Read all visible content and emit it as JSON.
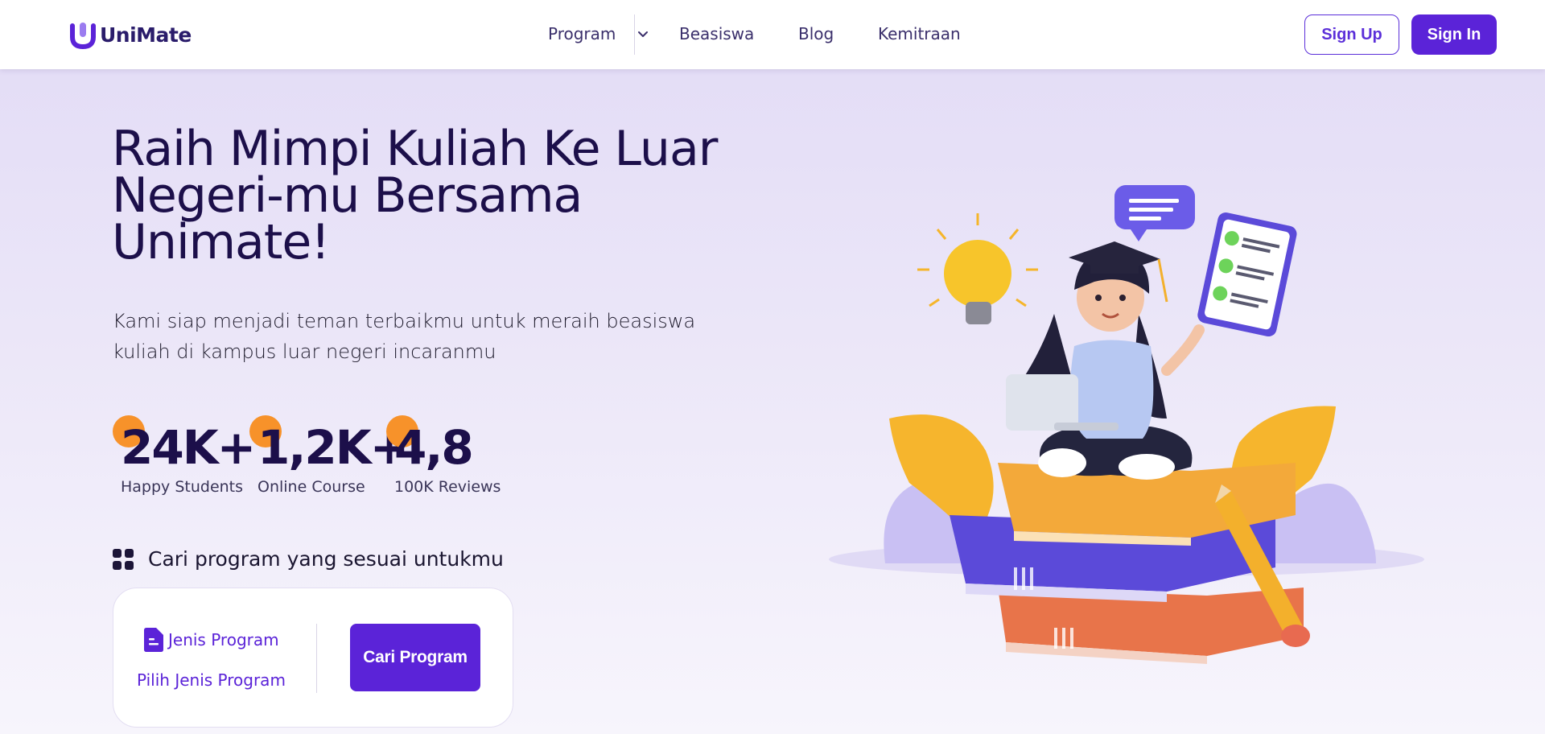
{
  "navbar": {
    "logo_text": "UniMate",
    "menu": {
      "program": "Program",
      "beasiswa": "Beasiswa",
      "blog": "Blog",
      "kemitraan": "Kemitraan"
    },
    "signup_label": "Sign Up",
    "signin_label": "Sign In"
  },
  "hero": {
    "title_line1": "Raih Mimpi Kuliah Ke Luar",
    "title_line2": "Negeri-mu Bersama",
    "title_line3": "Unimate!",
    "subtitle_line1": "Kami siap menjadi teman terbaikmu untuk meraih beasiswa",
    "subtitle_line2": "kuliah di kampus luar negeri incaranmu"
  },
  "stats": [
    {
      "value": "24K+",
      "label": "Happy Students"
    },
    {
      "value": "1,2K+",
      "label": "Online Course"
    },
    {
      "value": "4,8",
      "label": "100K Reviews"
    }
  ],
  "search": {
    "section_title": "Cari program yang sesuai untukmu",
    "jenis_label": "Jenis Program",
    "jenis_placeholder": "Pilih Jenis Program",
    "button_label": "Cari Program"
  },
  "colors": {
    "brand": "#5b23d8",
    "heading": "#1c0f4a",
    "accent_orange": "#f7922a"
  },
  "icons": {
    "logo": "unimate-logo-icon",
    "chevron": "chevron-down-icon",
    "grid": "grid-icon",
    "document": "document-icon"
  }
}
